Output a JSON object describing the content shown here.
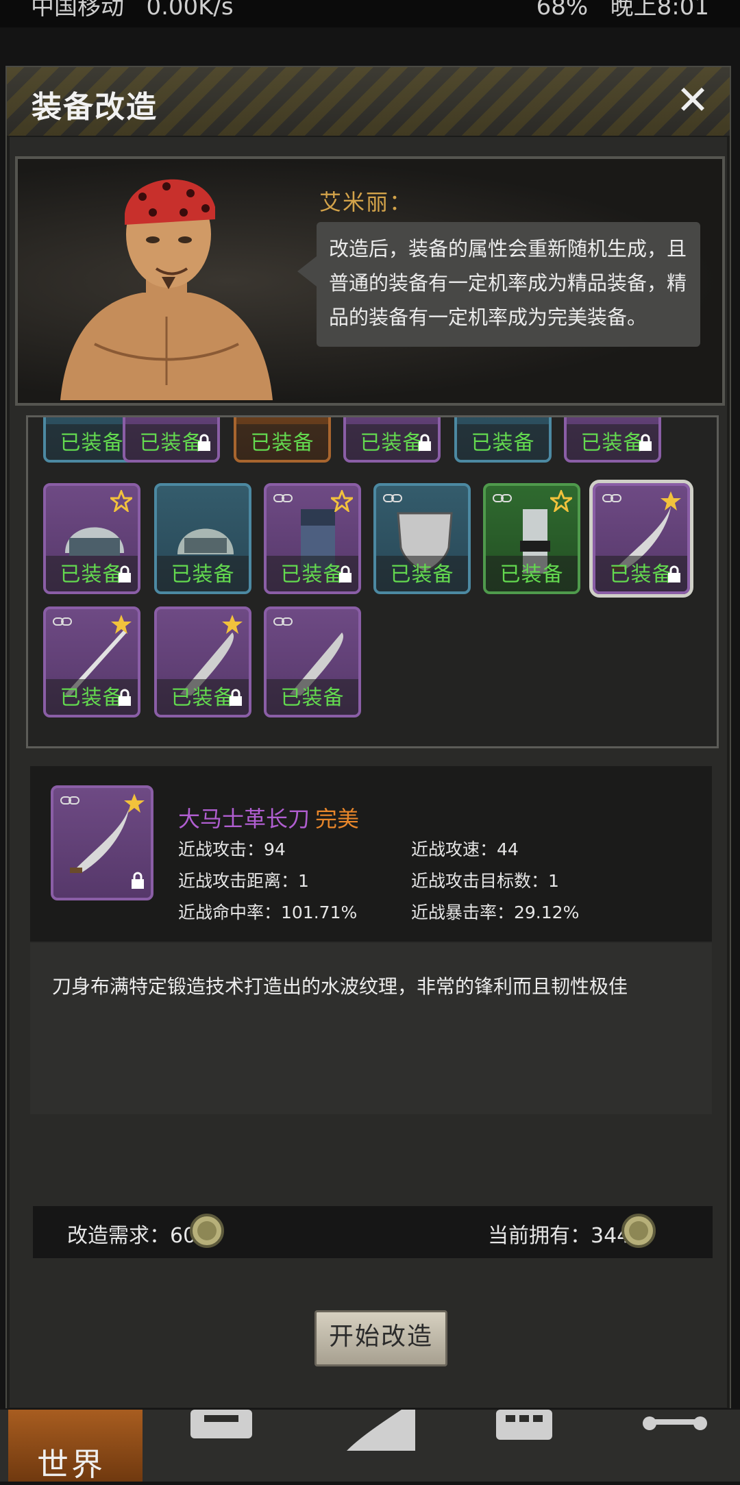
{
  "statusbar": {
    "carrier": "中国移动",
    "speed": "0.00K/s",
    "battery": "68%",
    "time": "晚上8:01"
  },
  "header": {
    "title": "装备改造",
    "close_glyph": "✕"
  },
  "npc": {
    "name": "艾米丽：",
    "speech": "改造后，装备的属性会重新随机生成，且普通的装备有一定机率成为精品装备，精品的装备有一定机率成为完美装备。"
  },
  "grid": {
    "equipped_label": "已装备",
    "rows": [
      {
        "name": "row-partial",
        "items": [
          "blue",
          "purple",
          "orange",
          "purple",
          "blue",
          "purple"
        ]
      },
      {
        "name": "row-1",
        "items": [
          "purple",
          "blue",
          "purple",
          "blue",
          "green",
          "purple"
        ]
      },
      {
        "name": "row-2",
        "items": [
          "purple",
          "purple",
          "purple"
        ]
      }
    ]
  },
  "detail": {
    "name": "大马士革长刀",
    "quality": "完美",
    "stats": {
      "melee_attack": "近战攻击：94",
      "melee_speed": "近战攻速：44",
      "melee_range": "近战攻击距离：1",
      "melee_targets": "近战攻击目标数：1",
      "melee_hit": "近战命中率：101.71%",
      "melee_crit": "近战暴击率：29.12%"
    },
    "description": "刀身布满特定锻造技术打造出的水波纹理，非常的锋利而且韧性极佳"
  },
  "cost": {
    "required": "改造需求：60",
    "owned": "当前拥有：344",
    "coin_icon": "bottle-cap-icon"
  },
  "actions": {
    "start": "开始改造"
  },
  "tabs": {
    "world": "世界"
  },
  "colors": {
    "purple": "#6e4a84",
    "blue": "#345c6c",
    "green": "#2f6a2f",
    "orange": "#7a4a24",
    "equipped_text": "#63d94f",
    "perfect": "#e8862a",
    "item_name": "#b05ed0"
  }
}
